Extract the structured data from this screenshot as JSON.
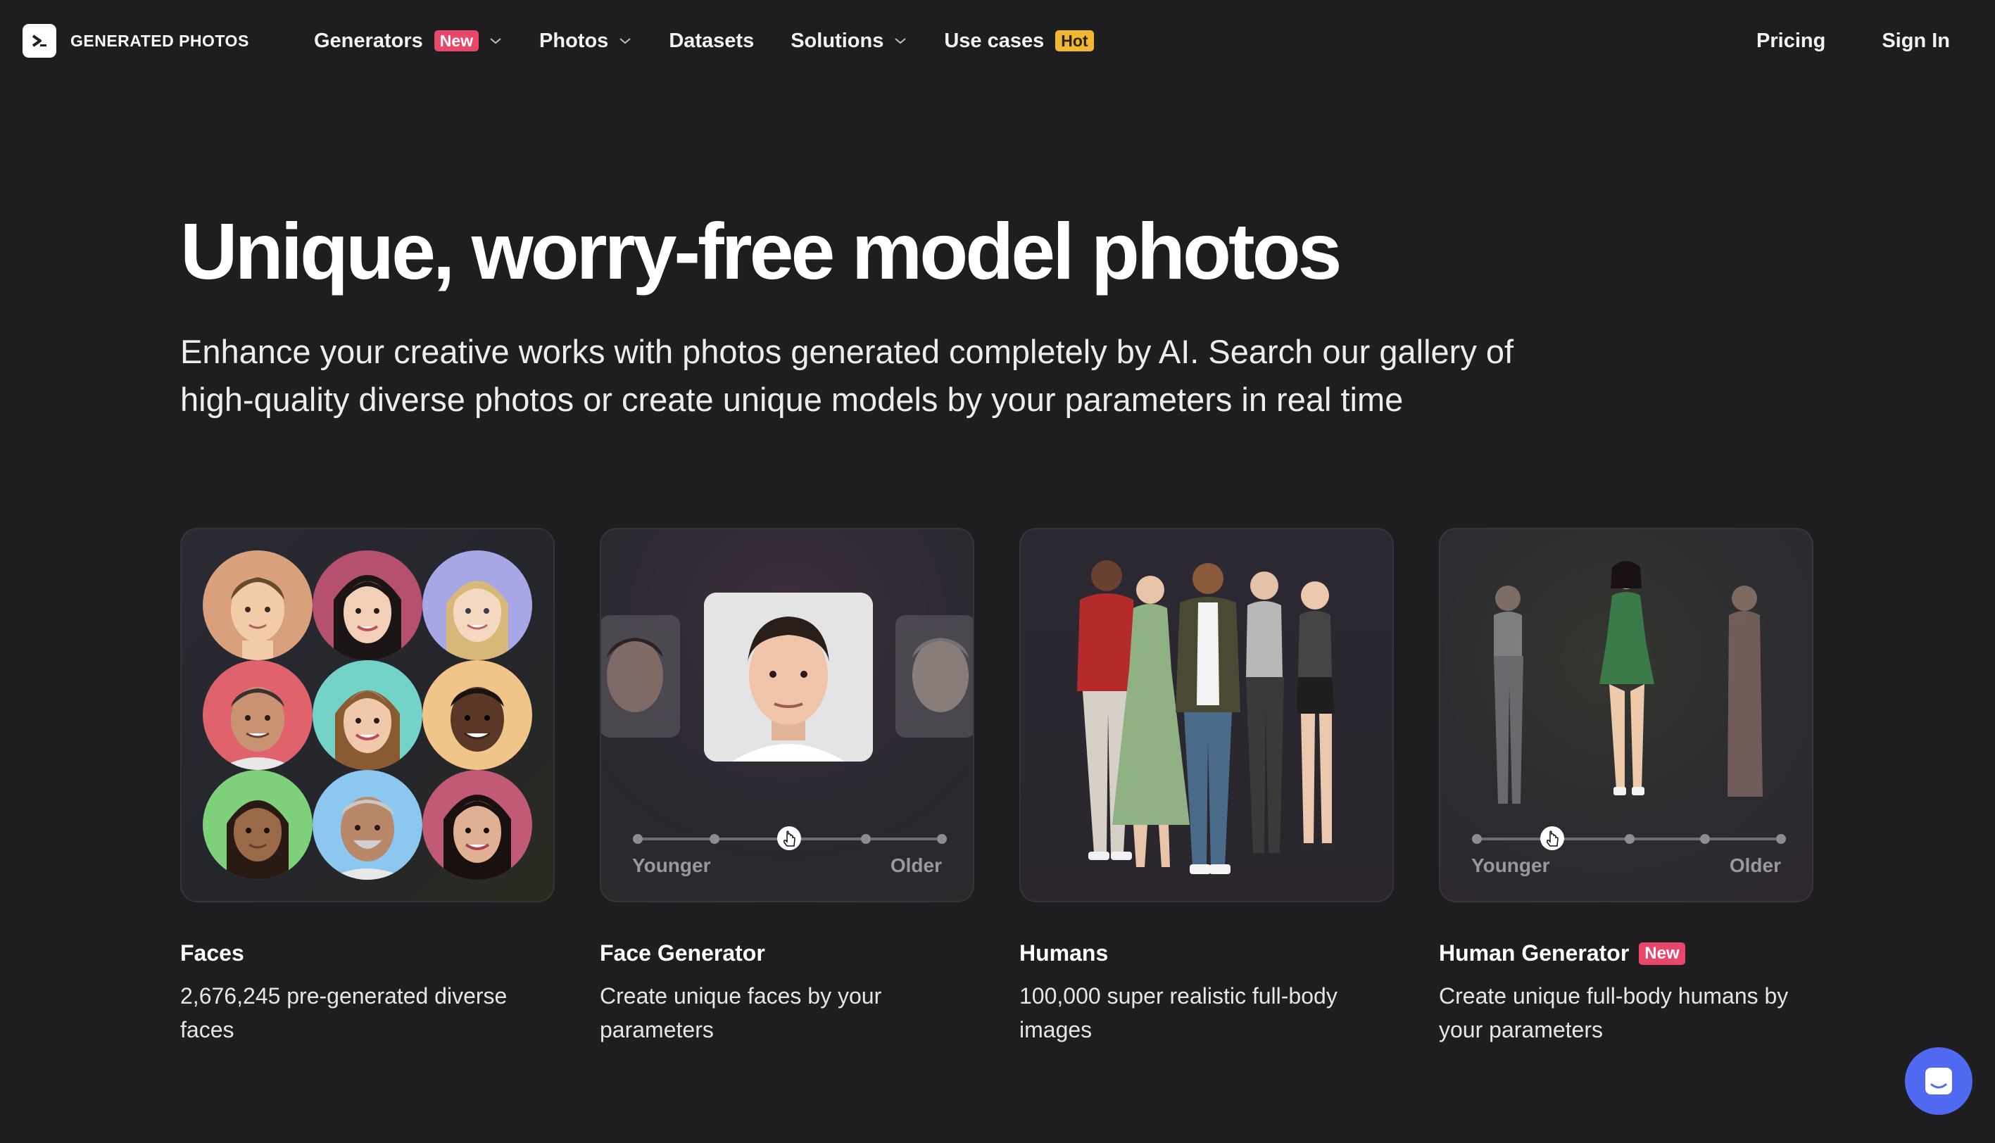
{
  "brand": {
    "name": "GENERATED PHOTOS"
  },
  "nav": {
    "items": [
      {
        "label": "Generators",
        "badge": "New",
        "badge_type": "new",
        "has_dropdown": true
      },
      {
        "label": "Photos",
        "badge": "",
        "has_dropdown": true
      },
      {
        "label": "Datasets",
        "badge": "",
        "has_dropdown": false
      },
      {
        "label": "Solutions",
        "badge": "",
        "has_dropdown": true
      },
      {
        "label": "Use cases",
        "badge": "Hot",
        "badge_type": "hot",
        "has_dropdown": false
      }
    ],
    "right": [
      {
        "label": "Pricing"
      },
      {
        "label": "Sign In"
      }
    ]
  },
  "hero": {
    "title": "Unique, worry-free model photos",
    "subtitle_line1": "Enhance your creative works with photos generated completely by AI. Search our gallery of",
    "subtitle_line2": "high-quality diverse photos or create unique models by your parameters in real time"
  },
  "cards": [
    {
      "title": "Faces",
      "badge": "",
      "desc_line1": "2,676,245 pre-generated diverse",
      "desc_line2": "faces"
    },
    {
      "title": "Face Generator",
      "badge": "",
      "desc_line1": "Create unique faces by your",
      "desc_line2": "parameters",
      "slider": {
        "min_label": "Younger",
        "max_label": "Older",
        "value": 0.5
      }
    },
    {
      "title": "Humans",
      "badge": "",
      "desc_line1": "100,000 super realistic full-body",
      "desc_line2": "images"
    },
    {
      "title": "Human Generator",
      "badge": "New",
      "desc_line1": "Create unique full-body humans by",
      "desc_line2": "your parameters",
      "slider": {
        "min_label": "Younger",
        "max_label": "Older",
        "value": 0.25
      }
    }
  ],
  "colors": {
    "background": "#1e1d1f",
    "badge_new": "#e8466b",
    "badge_hot": "#f2b731",
    "chat_button": "#4f6af0"
  },
  "icons": {
    "logo": "terminal-prompt-icon",
    "dropdown": "chevron-down-icon",
    "chat": "chat-bubble-icon",
    "slider_cursor": "hand-pointer-icon"
  }
}
